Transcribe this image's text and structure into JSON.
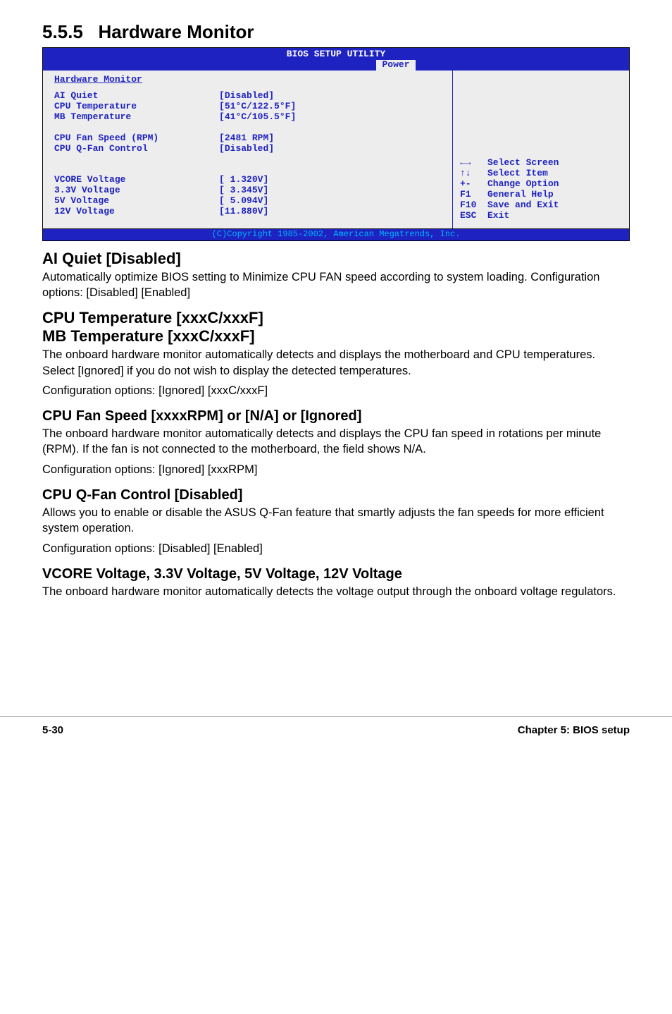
{
  "section_number": "5.5.5",
  "section_title": "Hardware Monitor",
  "bios": {
    "title": "BIOS SETUP UTILITY",
    "tab": "Power",
    "panel_header": "Hardware Monitor",
    "rows": [
      {
        "label": "AI Quiet",
        "value": "[Disabled]"
      },
      {
        "label": "CPU Temperature",
        "value": "[51°C/122.5°F]"
      },
      {
        "label": "MB Temperature",
        "value": "[41°C/105.5°F]"
      },
      {
        "label": "",
        "value": ""
      },
      {
        "label": "CPU Fan Speed (RPM)",
        "value": "[2481 RPM]"
      },
      {
        "label": "CPU Q-Fan Control",
        "value": "[Disabled]"
      },
      {
        "label": "",
        "value": ""
      },
      {
        "label": "",
        "value": ""
      },
      {
        "label": "VCORE Voltage",
        "value": "[ 1.320V]"
      },
      {
        "label": "3.3V Voltage",
        "value": "[ 3.345V]"
      },
      {
        "label": "5V Voltage",
        "value": "[ 5.094V]"
      },
      {
        "label": "12V Voltage",
        "value": "[11.880V]"
      }
    ],
    "help": [
      {
        "key": "←→",
        "text": "Select Screen"
      },
      {
        "key": "↑↓",
        "text": "Select Item"
      },
      {
        "key": "+-",
        "text": "Change Option"
      },
      {
        "key": "F1",
        "text": "General Help"
      },
      {
        "key": "F10",
        "text": "Save and Exit"
      },
      {
        "key": "ESC",
        "text": "Exit"
      }
    ],
    "copyright": "(C)Copyright 1985-2002, American Megatrends, Inc."
  },
  "ai_quiet": {
    "heading": "AI Quiet [Disabled]",
    "body": "Automatically optimize BIOS setting to Minimize CPU FAN speed according to system loading. Configuration options: [Disabled] [Enabled]"
  },
  "temp": {
    "heading1": "CPU Temperature [xxxC/xxxF]",
    "heading2": "MB Temperature [xxxC/xxxF]",
    "body1": "The onboard hardware monitor automatically detects and displays the motherboard and CPU temperatures. Select [Ignored] if you do not wish to display the detected temperatures.",
    "body2": "Configuration options: [Ignored] [xxxC/xxxF]"
  },
  "fan_speed": {
    "heading": "CPU Fan Speed [xxxxRPM] or [N/A] or [Ignored]",
    "body1": "The onboard hardware monitor automatically detects and displays the CPU fan speed in rotations per minute (RPM). If the fan is not connected to the motherboard, the field shows N/A.",
    "body2": "Configuration options: [Ignored] [xxxRPM]"
  },
  "qfan": {
    "heading": "CPU Q-Fan Control [Disabled]",
    "body1": "Allows you to enable or disable the ASUS Q-Fan feature that smartly adjusts the fan speeds for more efficient system operation.",
    "body2": "Configuration options: [Disabled] [Enabled]"
  },
  "voltage": {
    "heading": "VCORE Voltage, 3.3V Voltage, 5V Voltage, 12V Voltage",
    "body": "The onboard hardware monitor automatically detects the voltage output through the onboard voltage regulators."
  },
  "footer": {
    "page": "5-30",
    "chapter": "Chapter 5: BIOS setup"
  }
}
